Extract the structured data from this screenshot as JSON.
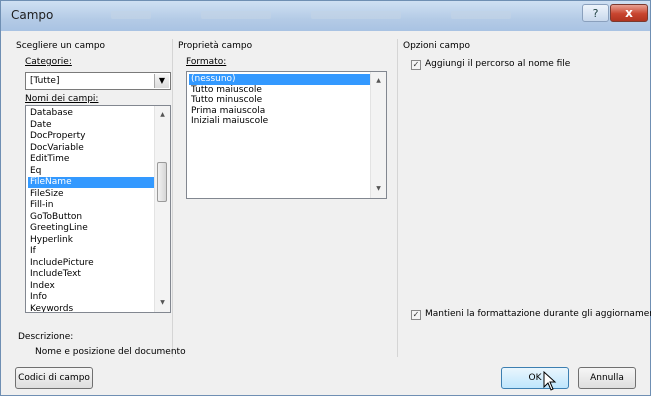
{
  "window": {
    "title": "Campo",
    "help_glyph": "?",
    "close_glyph": "x"
  },
  "left": {
    "heading": "Scegliere un campo",
    "categories_label": "Categorie:",
    "categories_value": "[Tutte]",
    "names_label": "Nomi dei campi:",
    "field_names": [
      "Database",
      "Date",
      "DocProperty",
      "DocVariable",
      "EditTime",
      "Eq",
      "FileName",
      "FileSize",
      "Fill-in",
      "GoToButton",
      "GreetingLine",
      "Hyperlink",
      "If",
      "IncludePicture",
      "IncludeText",
      "Index",
      "Info",
      "Keywords"
    ],
    "selected_index": 6,
    "description_label": "Descrizione:",
    "description_text": "Nome e posizione del documento"
  },
  "middle": {
    "heading": "Proprietà campo",
    "format_label": "Formato:",
    "formats": [
      "(nessuno)",
      "Tutto maiuscole",
      "Tutto minuscole",
      "Prima maiuscola",
      "Iniziali maiuscole"
    ],
    "selected_index": 0
  },
  "right": {
    "heading": "Opzioni campo",
    "option_add_path": "Aggiungi il percorso al nome file",
    "option_add_path_checked": true,
    "option_keep_format": "Mantieni la formattazione durante gli aggiornamenti",
    "option_keep_format_checked": true
  },
  "buttons": {
    "field_codes": "Codici di campo",
    "ok": "OK",
    "cancel": "Annulla"
  },
  "icons": {
    "dropdown": "chevron-down-icon",
    "scroll_up": "arrow-up-icon",
    "scroll_down": "arrow-down-icon",
    "check": "checkmark-icon",
    "cursor": "mouse-pointer-icon"
  }
}
